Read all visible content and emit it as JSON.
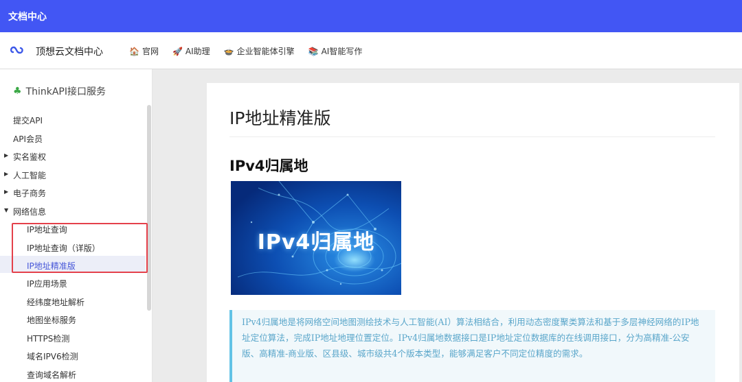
{
  "topbar": {
    "title": "文档中心"
  },
  "header": {
    "site_title": "顶想云文档中心",
    "nav": [
      {
        "emoji": "🏠",
        "label": "官网"
      },
      {
        "emoji": "🚀",
        "label": "AI助理"
      },
      {
        "emoji": "🍲",
        "label": "企业智能体引擎"
      },
      {
        "emoji": "📚",
        "label": "AI智能写作"
      }
    ]
  },
  "sidebar": {
    "heading": "ThinkAPI接口服务",
    "items": [
      {
        "label": "提交API"
      },
      {
        "label": "API会员"
      },
      {
        "label": "实名鉴权",
        "caret": "▶"
      },
      {
        "label": "人工智能",
        "caret": "▶"
      },
      {
        "label": "电子商务",
        "caret": "▶"
      },
      {
        "label": "网络信息",
        "caret": "▼"
      },
      {
        "label": "IP地址查询"
      },
      {
        "label": "IP地址查询（详版）"
      },
      {
        "label": "IP地址精准版"
      },
      {
        "label": "IP应用场景"
      },
      {
        "label": "经纬度地址解析"
      },
      {
        "label": "地图坐标服务"
      },
      {
        "label": "HTTPS检测"
      },
      {
        "label": "域名IPV6检测"
      },
      {
        "label": "查询域名解析"
      }
    ]
  },
  "content": {
    "page_title": "IP地址精准版",
    "section_title": "IPv4归属地",
    "banner_text": "IPv4归属地",
    "quote": "IPv4归属地是将网络空间地图测绘技术与人工智能(AI）算法相结合，利用动态密度聚类算法和基于多层神经网络的IP地址定位算法，完成IP地址地理位置定位。IPv4归属地数据接口是IP地址定位数据库的在线调用接口，分为高精准-公安版、高精准-商业版、区县级、城市级共4个版本类型，能够满足客户不同定位精度的需求。"
  }
}
